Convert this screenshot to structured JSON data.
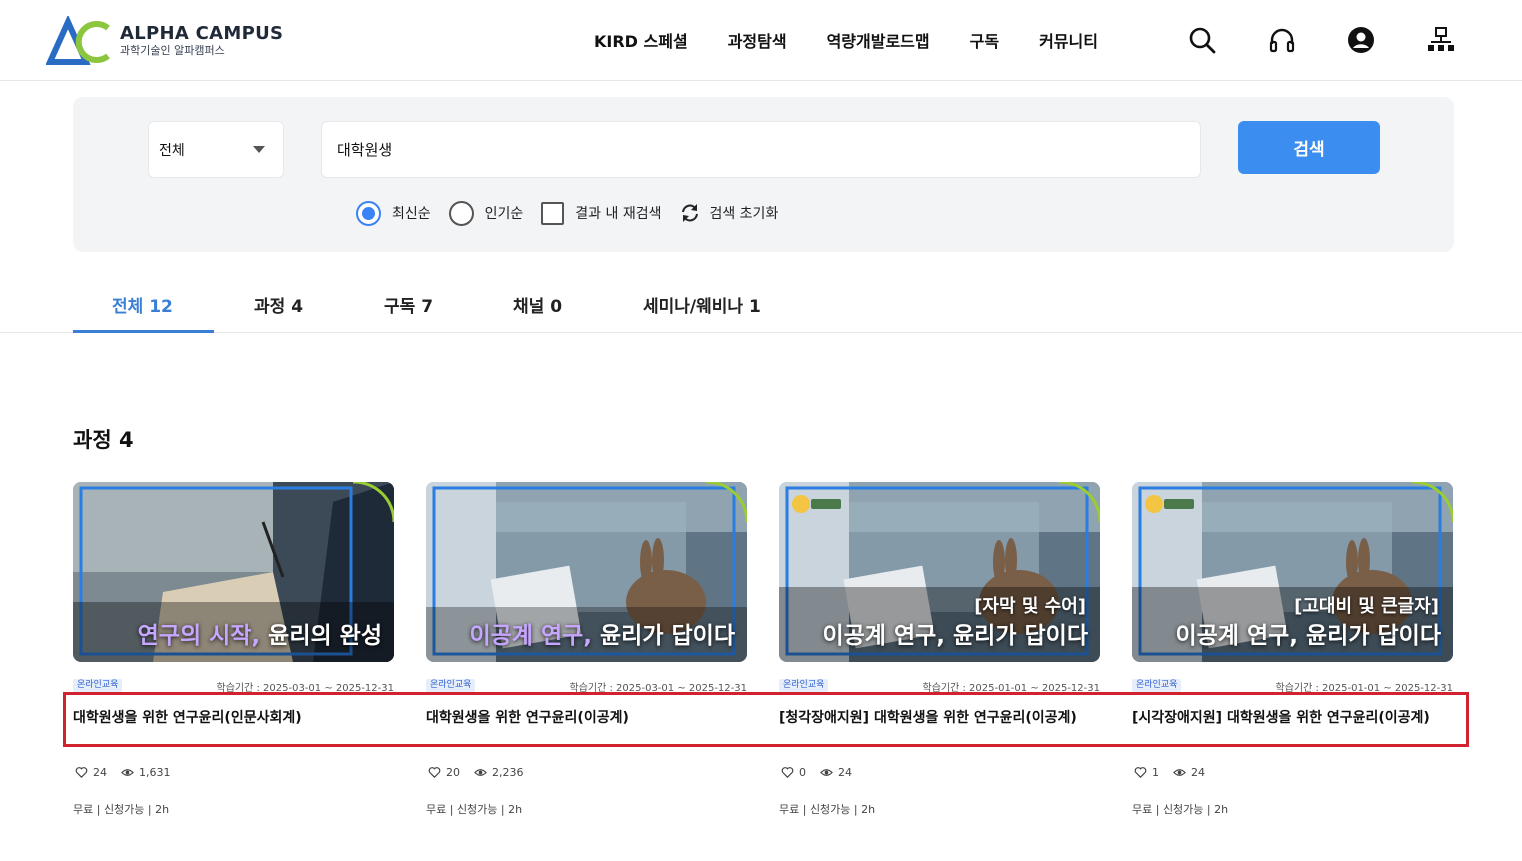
{
  "header": {
    "logo_title": "ALPHA CAMPUS",
    "logo_sub": "과학기술인 알파캠퍼스",
    "nav": [
      "KIRD 스페셜",
      "과정탐색",
      "역량개발로드맵",
      "구독",
      "커뮤니티"
    ],
    "icons": [
      "search-icon",
      "headset-icon",
      "user-icon",
      "sitemap-icon"
    ]
  },
  "search": {
    "category": "전체",
    "query": "대학원생",
    "button": "검색",
    "options": {
      "latest": "최신순",
      "popular": "인기순",
      "within": "결과 내 재검색",
      "reset": "검색 초기화"
    },
    "selected_sort": "최신순"
  },
  "tabs": [
    {
      "label": "전체 12",
      "active": true
    },
    {
      "label": "과정 4",
      "active": false
    },
    {
      "label": "구독 7",
      "active": false
    },
    {
      "label": "채널 0",
      "active": false
    },
    {
      "label": "세미나/웨비나 1",
      "active": false
    }
  ],
  "section": {
    "title": "과정 4"
  },
  "courses": [
    {
      "thumb_title_hl": "연구의 시작,",
      "thumb_title_rest": " 윤리의 완성",
      "thumb_sub": "",
      "badge": "온라인교육",
      "period": "학습기간 : 2025-03-01 ~ 2025-12-31",
      "title": "대학원생을 위한 연구윤리(인문사회계)",
      "likes": "24",
      "views": "1,631",
      "info": "무료 | 신청가능 | 2h"
    },
    {
      "thumb_title_hl": "이공계 연구,",
      "thumb_title_rest": " 윤리가 답이다",
      "thumb_sub": "",
      "badge": "온라인교육",
      "period": "학습기간 : 2025-03-01 ~ 2025-12-31",
      "title": "대학원생을 위한 연구윤리(이공계)",
      "likes": "20",
      "views": "2,236",
      "info": "무료 | 신청가능 | 2h"
    },
    {
      "thumb_title_hl": "",
      "thumb_title_rest": "이공계 연구, 윤리가 답이다",
      "thumb_sub": "[자막 및 수어]",
      "badge": "온라인교육",
      "period": "학습기간 : 2025-01-01 ~ 2025-12-31",
      "title": "[청각장애지원] 대학원생을 위한 연구윤리(이공계)",
      "likes": "0",
      "views": "24",
      "info": "무료 | 신청가능 | 2h"
    },
    {
      "thumb_title_hl": "",
      "thumb_title_rest": "이공계 연구, 윤리가 답이다",
      "thumb_sub": "[고대비 및 큰글자]",
      "badge": "온라인교육",
      "period": "학습기간 : 2025-01-01 ~ 2025-12-31",
      "title": "[시각장애지원] 대학원생을 위한 연구윤리(이공계)",
      "likes": "1",
      "views": "24",
      "info": "무료 | 신청가능 | 2h"
    }
  ],
  "colors": {
    "accent": "#3a7fd5",
    "button": "#3b8ef0",
    "highlight": "#d3222f",
    "thumb_highlight_text": "#c7a6ff"
  }
}
